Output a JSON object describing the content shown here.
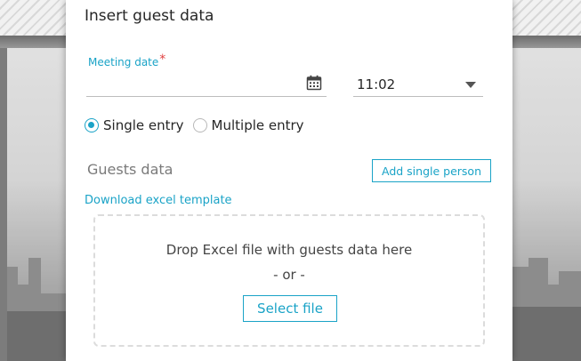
{
  "dialog": {
    "title": "Insert guest data"
  },
  "meeting": {
    "date_label": "Meeting date",
    "required_mark": "*",
    "date_value": "",
    "calendar_icon": "calendar-icon",
    "time_value": "11:02",
    "time_dropdown_icon": "caret-down-icon"
  },
  "entry_mode": {
    "options": [
      {
        "label": "Single entry",
        "selected": true
      },
      {
        "label": "Multiple entry",
        "selected": false
      }
    ]
  },
  "guests": {
    "section_title": "Guests data",
    "add_button_label": "Add single person",
    "download_link": "Download excel template"
  },
  "dropzone": {
    "instruction": "Drop Excel file with guests data here",
    "separator": "- or -",
    "select_button_label": "Select file"
  },
  "colors": {
    "accent": "#1aa3c7",
    "required": "#e04040"
  }
}
